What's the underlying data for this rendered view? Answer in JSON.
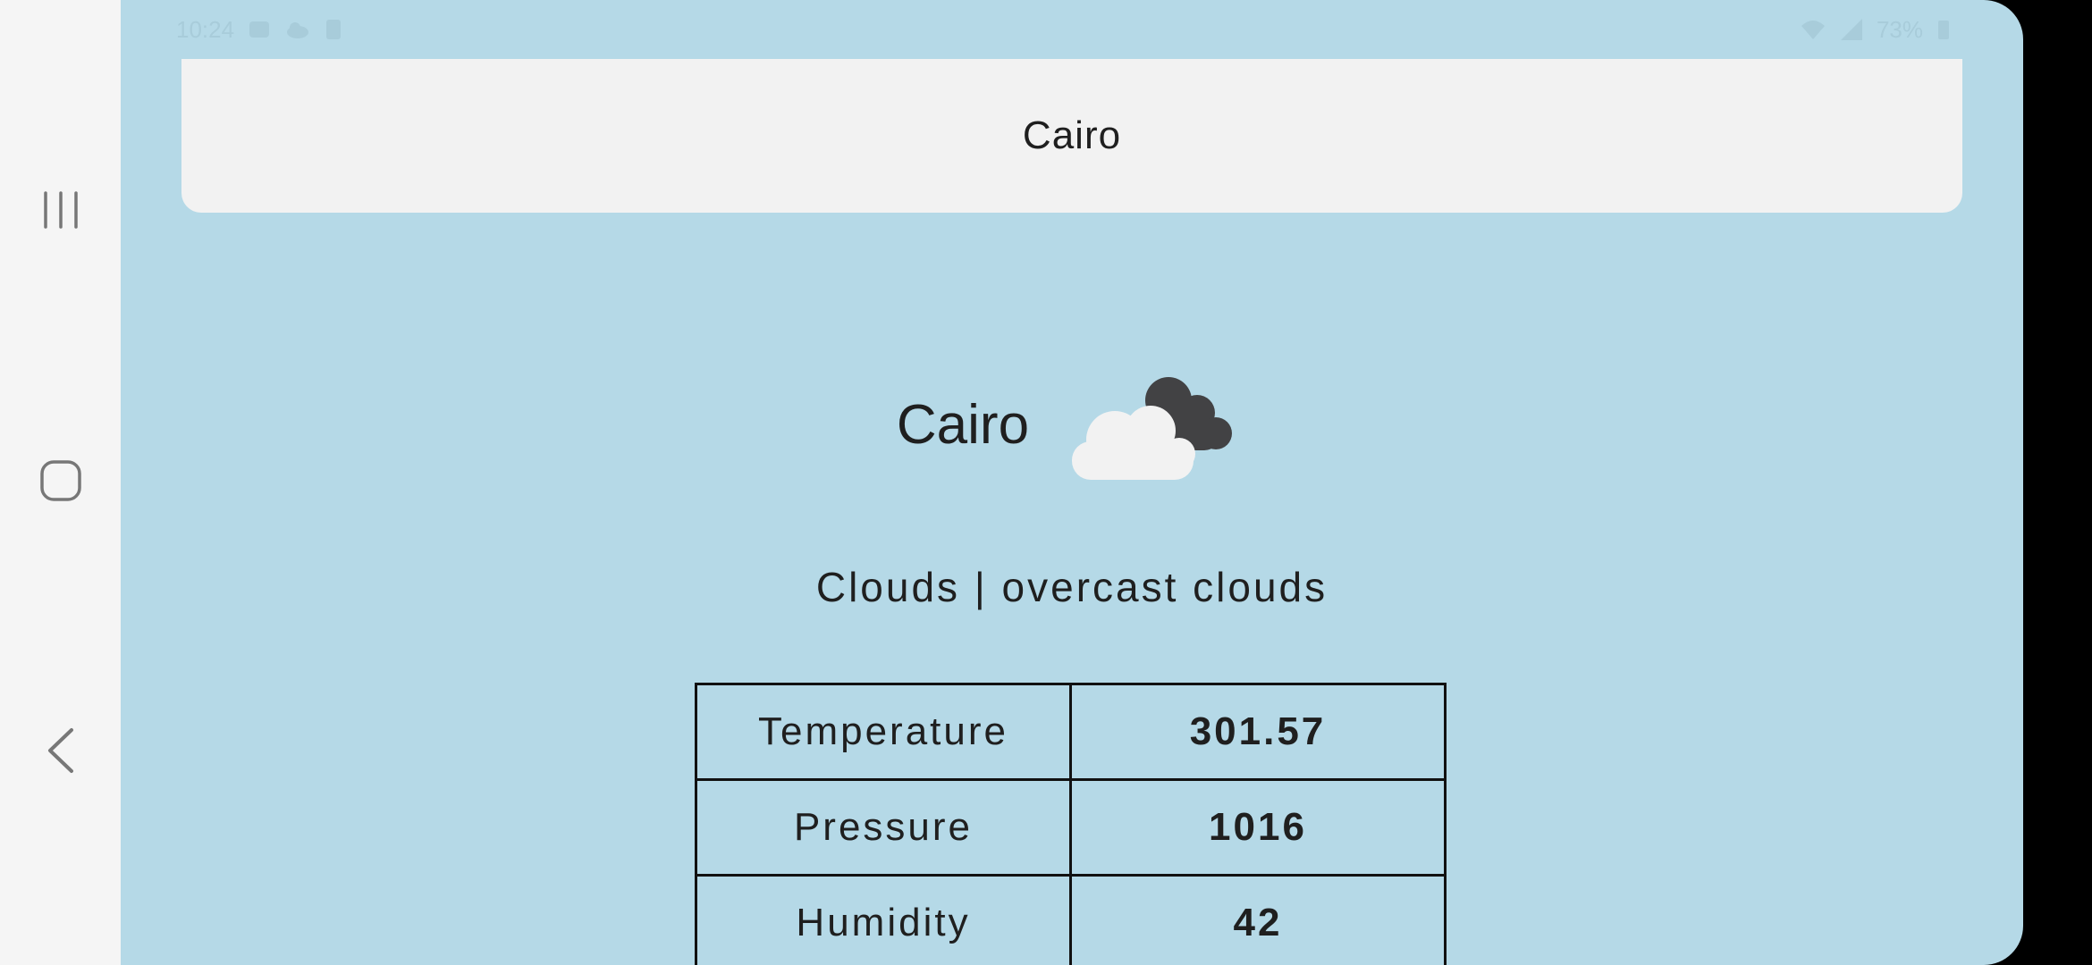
{
  "status_bar": {
    "time": "10:24",
    "battery": "73%"
  },
  "search": {
    "city_value": "Cairo"
  },
  "weather": {
    "city": "Cairo",
    "icon": "overcast-clouds-icon",
    "description": "Clouds | overcast clouds",
    "rows": [
      {
        "label": "Temperature",
        "value": "301.57"
      },
      {
        "label": "Pressure",
        "value": "1016"
      },
      {
        "label": "Humidity",
        "value": "42"
      }
    ]
  },
  "colors": {
    "background": "#b5d9e7",
    "card": "#f2f2f2",
    "nav_bar": "#f5f5f5",
    "text": "#1f1f1f"
  }
}
